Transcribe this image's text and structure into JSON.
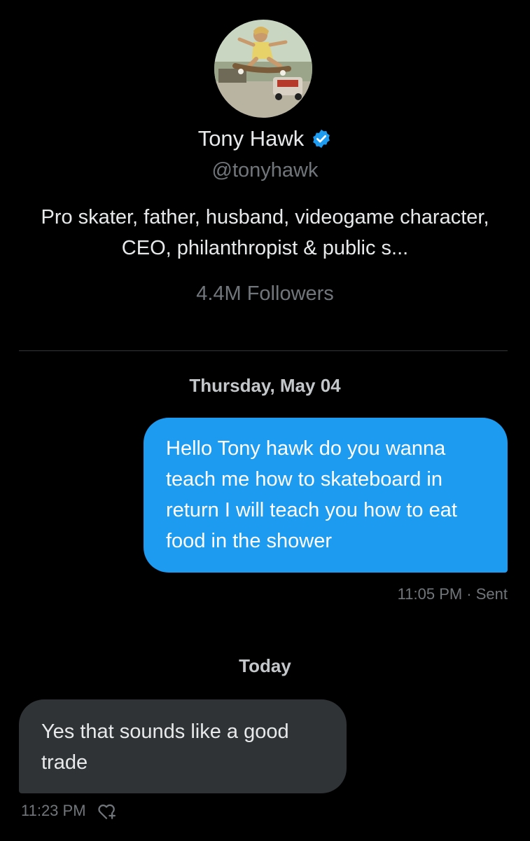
{
  "profile": {
    "display_name": "Tony Hawk",
    "handle": "@tonyhawk",
    "bio": "Pro skater, father, husband, videogame character, CEO, philanthropist & public s...",
    "followers": "4.4M Followers",
    "verified_icon": "verified-badge-icon",
    "avatar": "profile-photo-skateboarder"
  },
  "conversation": {
    "groups": [
      {
        "date_label": "Thursday, May 04",
        "message": {
          "direction": "outgoing",
          "text": "Hello Tony hawk do you wanna teach me how to skateboard in return I will teach you how to eat food in the shower",
          "meta": "11:05 PM · Sent"
        }
      },
      {
        "date_label": "Today",
        "message": {
          "direction": "incoming",
          "text": "Yes that sounds like a good trade",
          "time": "11:23 PM",
          "reaction_icon": "add-reaction-heart-icon"
        }
      }
    ]
  },
  "colors": {
    "background": "#000000",
    "outgoing_bubble": "#1d9bf0",
    "incoming_bubble": "#2f3336",
    "primary_text": "#e7e9ea",
    "secondary_text": "#71767b",
    "verified": "#1d9bf0"
  }
}
